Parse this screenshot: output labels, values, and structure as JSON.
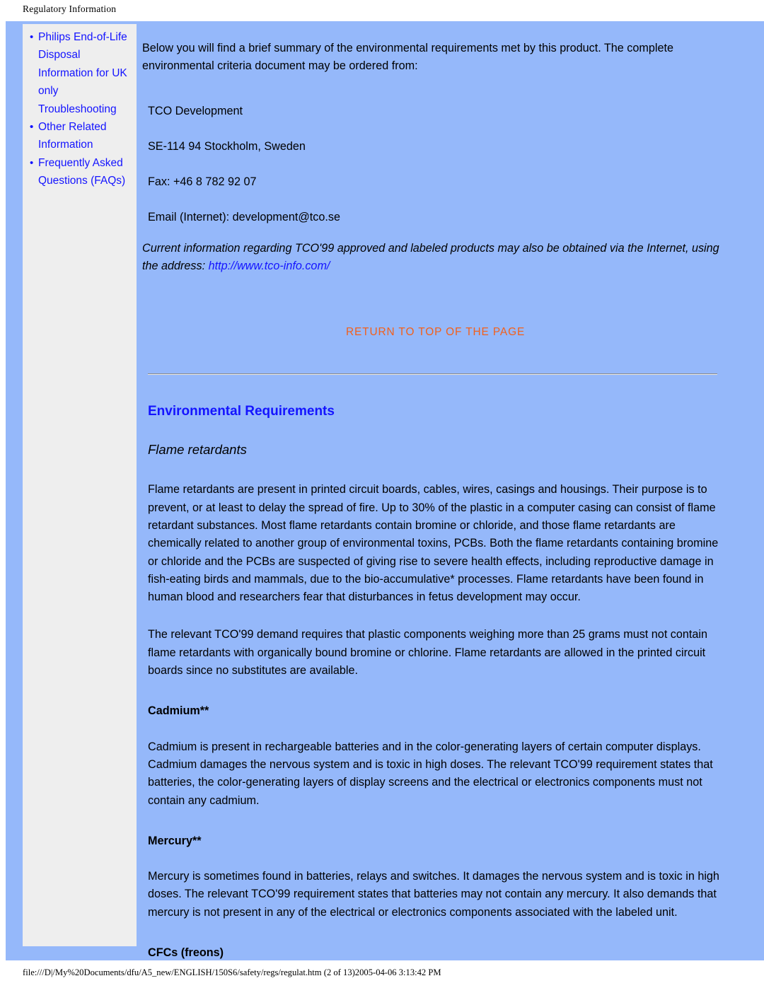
{
  "header": {
    "running_title": "Regulatory Information"
  },
  "sidebar": {
    "items": [
      {
        "label": "Philips End-of-Life Disposal Information for UK only"
      },
      {
        "label": "Troubleshooting"
      },
      {
        "label": "Other Related Information"
      },
      {
        "label": "Frequently Asked Questions (FAQs)"
      }
    ]
  },
  "article": {
    "intro": "Below you will find a brief summary of the environmental requirements met by this product. The complete environmental criteria document may be ordered from:",
    "address": {
      "org": "TCO Development",
      "city": "SE-114 94 Stockholm, Sweden",
      "fax": "Fax: +46 8 782 92 07",
      "email": "Email (Internet): development@tco.se"
    },
    "italic_note_prefix": "Current information regarding TCO'99 approved and labeled products may also be obtained via the Internet, using the address: ",
    "italic_note_link": "http://www.tco-info.com/",
    "return_to_top": "RETURN TO TOP OF THE PAGE",
    "section_title": "Environmental Requirements",
    "flame_sub_title": "Flame retardants",
    "flame_para_1": "Flame retardants are present in printed circuit boards, cables, wires, casings and housings. Their purpose is to prevent, or at least to delay the spread of fire. Up to 30% of the plastic in a computer casing can consist of flame retardant substances. Most flame retardants contain bromine or chloride, and those flame retardants are chemically related to another group of environmental toxins, PCBs. Both the flame retardants containing bromine or chloride and the PCBs are suspected of giving rise to severe health effects, including reproductive damage in fish-eating birds and mammals, due to the bio-accumulative* processes. Flame retardants have been found in human blood and researchers fear that disturbances in fetus development may occur.",
    "flame_para_2": "The relevant TCO'99 demand requires that plastic components weighing more than 25 grams must not contain flame retardants with organically bound bromine or chlorine. Flame retardants are allowed in the printed circuit boards since no substitutes are available.",
    "cadmium_title": "Cadmium**",
    "cadmium_para": "Cadmium is present in rechargeable batteries and in the color-generating layers of certain computer displays. Cadmium damages the nervous system and is toxic in high doses. The relevant TCO'99 requirement states that batteries, the color-generating layers of display screens and the electrical or electronics components must not contain any cadmium.",
    "mercury_title": "Mercury**",
    "mercury_para": "Mercury is sometimes found in batteries, relays and switches. It damages the nervous system and is toxic in high doses. The relevant TCO'99 requirement states that batteries may not contain any mercury. It also demands that mercury is not present in any of the electrical or electronics components associated with the labeled unit.",
    "cfc_title": "CFCs (freons)"
  },
  "footer": {
    "path_text": "file:///D|/My%20Documents/dfu/A5_new/ENGLISH/150S6/safety/regs/regulat.htm (2 of 13)2005-04-06 3:13:42 PM"
  },
  "colors": {
    "page_background": "#95b8fa",
    "sidebar_background": "#eeeeee",
    "link_blue": "#1414ff",
    "accent_orange": "#f2601b",
    "body_text": "#000000"
  }
}
